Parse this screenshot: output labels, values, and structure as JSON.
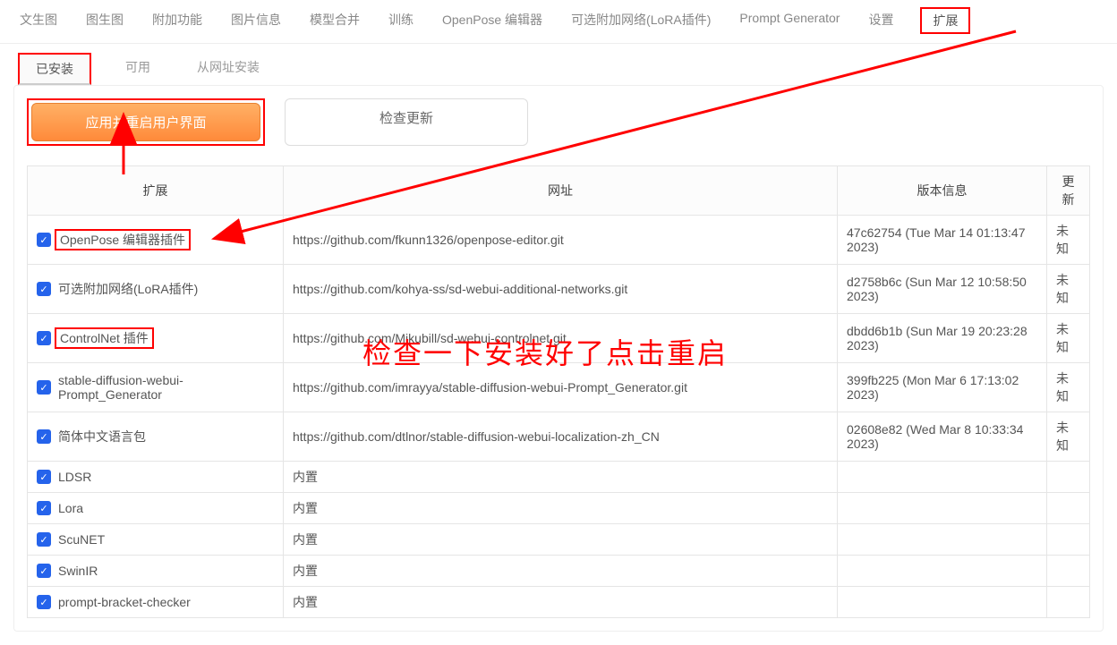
{
  "mainTabs": [
    "文生图",
    "图生图",
    "附加功能",
    "图片信息",
    "模型合并",
    "训练",
    "OpenPose 编辑器",
    "可选附加网络(LoRA插件)",
    "Prompt Generator",
    "设置",
    "扩展"
  ],
  "mainActiveIndex": 10,
  "subTabs": [
    "已安装",
    "可用",
    "从网址安装"
  ],
  "subActiveIndex": 0,
  "buttons": {
    "apply": "应用并重启用户界面",
    "check": "检查更新"
  },
  "tableHeaders": [
    "扩展",
    "网址",
    "版本信息",
    "更新"
  ],
  "extensions": [
    {
      "name": "OpenPose 编辑器插件",
      "url": "https://github.com/fkunn1326/openpose-editor.git",
      "version": "47c62754 (Tue Mar 14 01:13:47 2023)",
      "update": "未知",
      "highlight": true
    },
    {
      "name": "可选附加网络(LoRA插件)",
      "url": "https://github.com/kohya-ss/sd-webui-additional-networks.git",
      "version": "d2758b6c (Sun Mar 12 10:58:50 2023)",
      "update": "未知",
      "highlight": false
    },
    {
      "name": "ControlNet 插件",
      "url": "https://github.com/Mikubill/sd-webui-controlnet.git",
      "version": "dbdd6b1b (Sun Mar 19 20:23:28 2023)",
      "update": "未知",
      "highlight": true
    },
    {
      "name": "stable-diffusion-webui-Prompt_Generator",
      "url": "https://github.com/imrayya/stable-diffusion-webui-Prompt_Generator.git",
      "version": "399fb225 (Mon Mar 6 17:13:02 2023)",
      "update": "未知",
      "highlight": false
    },
    {
      "name": "简体中文语言包",
      "url": "https://github.com/dtlnor/stable-diffusion-webui-localization-zh_CN",
      "version": "02608e82 (Wed Mar 8 10:33:34 2023)",
      "update": "未知",
      "highlight": false
    },
    {
      "name": "LDSR",
      "url": "内置",
      "version": "",
      "update": "",
      "highlight": false
    },
    {
      "name": "Lora",
      "url": "内置",
      "version": "",
      "update": "",
      "highlight": false
    },
    {
      "name": "ScuNET",
      "url": "内置",
      "version": "",
      "update": "",
      "highlight": false
    },
    {
      "name": "SwinIR",
      "url": "内置",
      "version": "",
      "update": "",
      "highlight": false
    },
    {
      "name": "prompt-bracket-checker",
      "url": "内置",
      "version": "",
      "update": "",
      "highlight": false
    }
  ],
  "annotation": "检查一下安装好了点击重启"
}
